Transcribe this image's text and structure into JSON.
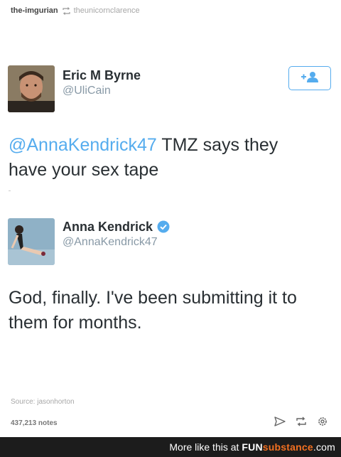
{
  "header": {
    "blog": "the-imgurian",
    "via": "theunicornclarence"
  },
  "tweets": [
    {
      "name": "Eric M Byrne",
      "handle": "@UliCain",
      "mention": "@AnnaKendrick47",
      "text": " TMZ says they have your sex tape"
    },
    {
      "name": "Anna Kendrick",
      "handle": "@AnnaKendrick47",
      "text": "God, finally. I've been submitting it to them for months."
    }
  ],
  "post": {
    "source": "Source: jasonhorton",
    "notes": "437,213 notes"
  },
  "footer": {
    "more": "More like this at",
    "brand_fun": "FUN",
    "brand_sub": "substance",
    "brand_suffix": ".com"
  },
  "colors": {
    "twitter_blue": "#55acee",
    "footer_bg": "#1c1c1c",
    "brand_orange": "#f37021"
  }
}
